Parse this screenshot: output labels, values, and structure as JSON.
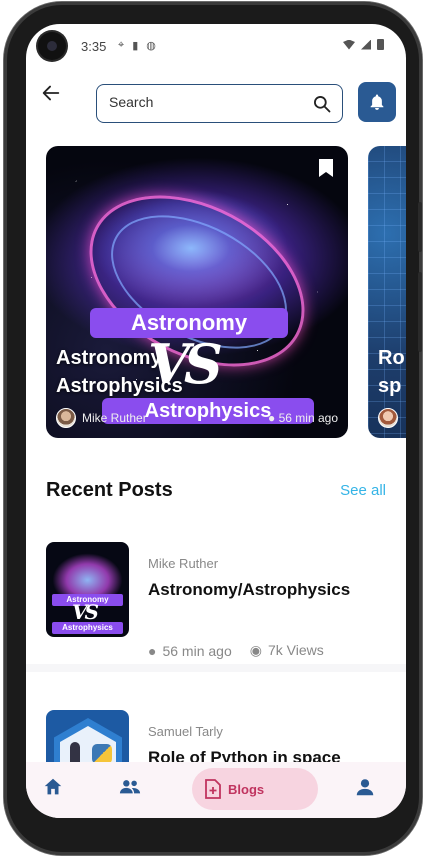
{
  "status_bar": {
    "time": "3:35",
    "icons_left": [
      "location-icon",
      "sd-card-icon",
      "android-icon"
    ],
    "icons_right": [
      "wifi-icon",
      "signal-icon",
      "battery-icon"
    ]
  },
  "header": {
    "search": {
      "placeholder": "Search",
      "value": ""
    },
    "icons": [
      "back-arrow-icon",
      "search-icon",
      "bell-icon"
    ]
  },
  "featured": [
    {
      "art_text_top": "Astronomy",
      "art_text_vs": "VS",
      "art_text_bottom": "Astrophysics",
      "title_line1": "Astronomy",
      "title_line2": "Astrophysics",
      "author": "Mike Ruther",
      "time": "56 min ago"
    },
    {
      "title_line1": "Ro",
      "title_line2": "sp"
    }
  ],
  "recent": {
    "title": "Recent Posts",
    "see_all": "See all",
    "posts": [
      {
        "author": "Mike Ruther",
        "title": "Astronomy/Astrophysics",
        "time": "56 min ago",
        "views": "7k Views",
        "thumb_tag_top": "Astronomy",
        "thumb_vs": "VS",
        "thumb_tag_bottom": "Astrophysics"
      },
      {
        "author": "Samuel Tarly",
        "title": "Role of Python in space"
      }
    ]
  },
  "bottom_nav": {
    "items": [
      {
        "icon": "home-icon",
        "label": ""
      },
      {
        "icon": "people-icon",
        "label": ""
      },
      {
        "icon": "add-document-icon",
        "label": "Blogs"
      },
      {
        "icon": "profile-icon",
        "label": ""
      }
    ],
    "active_color": "#c0335f"
  },
  "colors": {
    "accent": "#2a5a93",
    "link": "#35b4e6",
    "tag_purple": "#8a4dee"
  }
}
